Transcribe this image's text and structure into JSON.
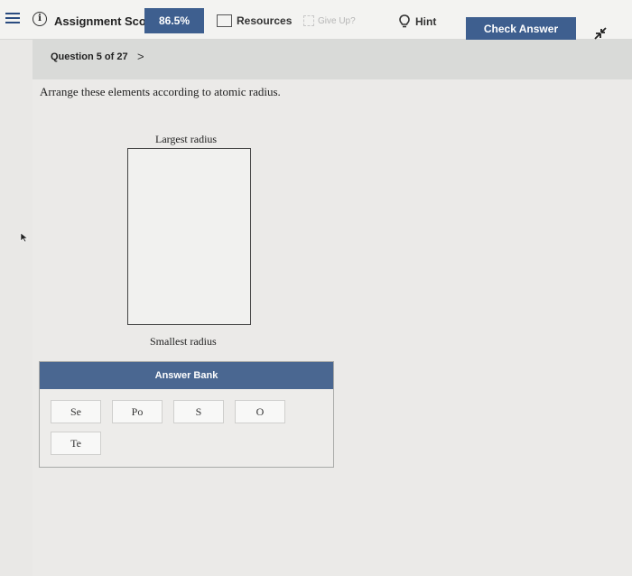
{
  "header": {
    "score_label": "Assignment Score:",
    "score_value": "86.5%",
    "resources_label": "Resources",
    "giveup_label": "Give Up?",
    "hint_label": "Hint",
    "check_label": "Check Answer"
  },
  "question": {
    "counter": "Question 5 of 27",
    "next_glyph": ">",
    "prompt": "Arrange these elements according to atomic radius.",
    "top_label": "Largest radius",
    "bottom_label": "Smallest radius"
  },
  "answer_bank": {
    "title": "Answer Bank",
    "items": [
      "Se",
      "Po",
      "S",
      "O",
      "Te"
    ]
  },
  "colors": {
    "accent": "#3e5f8f",
    "bank_header": "#4a6791"
  }
}
